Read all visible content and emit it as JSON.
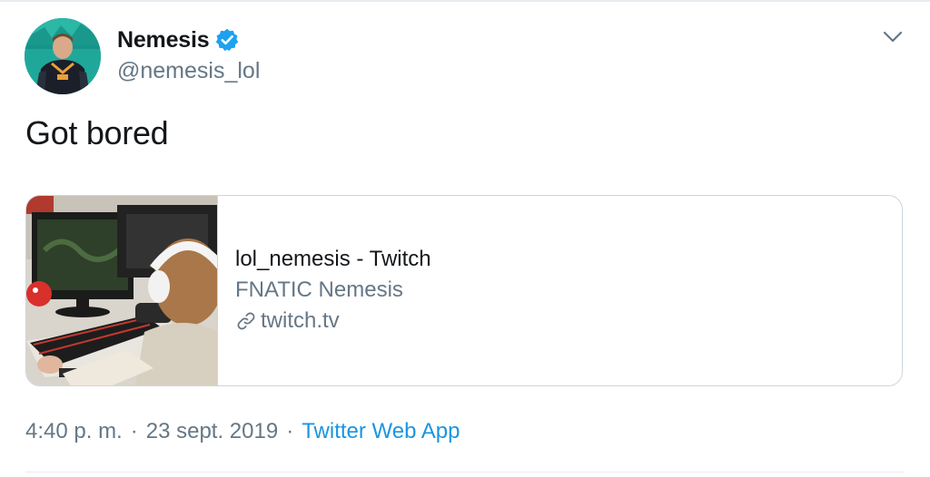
{
  "author": {
    "display_name": "Nemesis",
    "handle": "@nemesis_lol",
    "verified": true
  },
  "tweet": {
    "text": "Got bored"
  },
  "card": {
    "title": "lol_nemesis - Twitch",
    "description": "FNATIC Nemesis",
    "domain": "twitch.tv"
  },
  "meta": {
    "time": "4:40 p. m.",
    "separator": "·",
    "date": "23 sept. 2019",
    "source": "Twitter Web App"
  },
  "colors": {
    "text": "#14171a",
    "secondary": "#657786",
    "link": "#1b95e0",
    "verified_badge": "#1da1f2",
    "border": "#ccd6dd",
    "avatar_bg": "#1fa89a"
  },
  "icons": {
    "verified": "verified-badge-icon",
    "caret": "chevron-down-icon",
    "link": "link-icon"
  }
}
